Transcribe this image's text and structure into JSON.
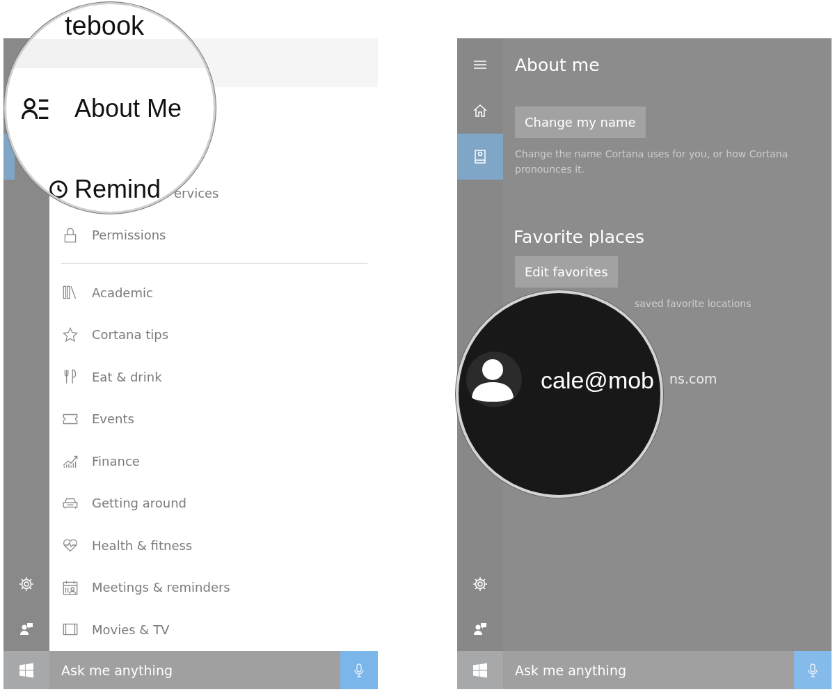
{
  "left_panel": {
    "rail": {
      "items": [
        {
          "selected": false
        },
        {
          "selected": false
        },
        {
          "selected": true
        }
      ],
      "bottom": [
        {
          "kind": "settings"
        },
        {
          "kind": "feedback"
        }
      ]
    },
    "covered_item": "ervices",
    "groups": [
      [
        {
          "kind": "lock",
          "label": "Permissions"
        }
      ],
      [
        {
          "kind": "books",
          "label": "Academic"
        },
        {
          "kind": "star",
          "label": "Cortana tips"
        },
        {
          "kind": "utensils",
          "label": "Eat & drink"
        },
        {
          "kind": "ticket",
          "label": "Events"
        },
        {
          "kind": "chart",
          "label": "Finance"
        },
        {
          "kind": "car",
          "label": "Getting around"
        },
        {
          "kind": "heart",
          "label": "Health & fitness"
        },
        {
          "kind": "calendar",
          "label": "Meetings & reminders"
        },
        {
          "kind": "film",
          "label": "Movies & TV"
        }
      ]
    ],
    "search": {
      "placeholder": "Ask me anything"
    }
  },
  "left_magnifier": {
    "heading": "tebook",
    "items": [
      {
        "kind": "about",
        "label": "About Me"
      },
      {
        "kind": "reminder",
        "label": "Remind"
      }
    ]
  },
  "right_panel": {
    "rail": {
      "items": [
        {
          "kind": "menu",
          "selected": false
        },
        {
          "kind": "home",
          "selected": false
        },
        {
          "kind": "notebook",
          "selected": true
        }
      ],
      "bottom": [
        {
          "kind": "settings"
        },
        {
          "kind": "feedback"
        }
      ]
    },
    "content": [
      {
        "kind": "title",
        "text": "About me"
      },
      {
        "kind": "button",
        "text": "Change my name"
      },
      {
        "kind": "note",
        "text": "Change the name Cortana uses for you, or how Cortana pronounces it."
      },
      {
        "kind": "heading",
        "text": "Favorite places"
      },
      {
        "kind": "button",
        "text": "Edit favorites"
      },
      {
        "kind": "covered_note",
        "text": "saved favorite locations"
      },
      {
        "kind": "covered_account",
        "text": "ns.com"
      }
    ],
    "search": {
      "placeholder": "Ask me anything"
    }
  },
  "right_magnifier": {
    "account": "cale@mob"
  }
}
